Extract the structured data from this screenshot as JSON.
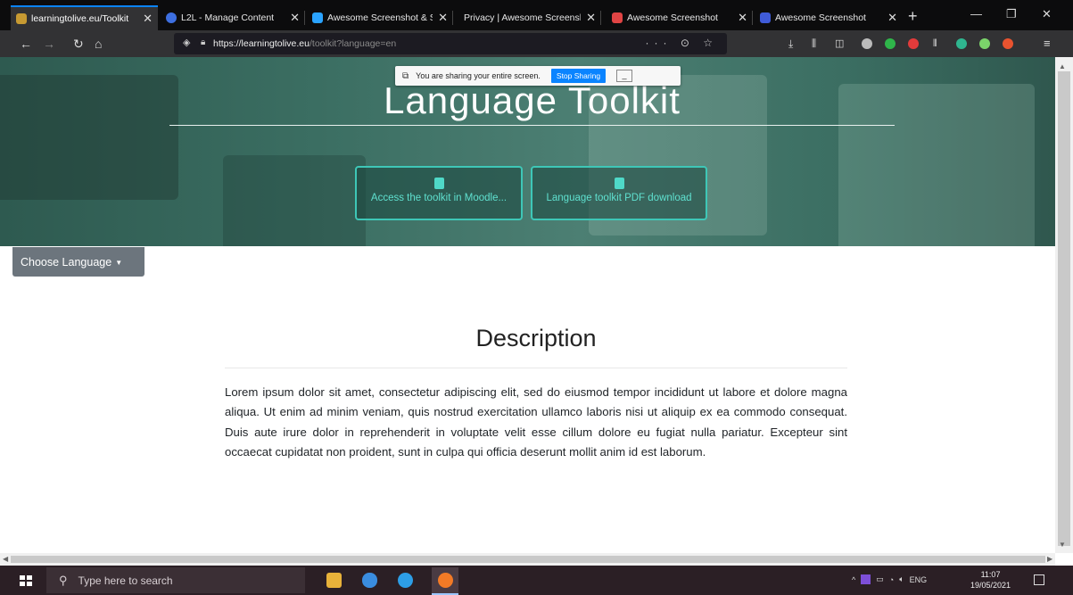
{
  "browser": {
    "tabs": [
      {
        "title": "learningtolive.eu/Toolkit",
        "active": true,
        "favicon_color": "#c79a32"
      },
      {
        "title": "L2L - Manage Content",
        "active": false,
        "favicon_color": "#3d6fe0"
      },
      {
        "title": "Awesome Screenshot & S",
        "active": false,
        "favicon_color": "#2aa3ff"
      },
      {
        "title": "Privacy | Awesome Screenshot",
        "active": false,
        "favicon_color": ""
      },
      {
        "title": "Awesome Screenshot",
        "active": false,
        "favicon_color": "#e04444"
      },
      {
        "title": "Awesome Screenshot",
        "active": false,
        "favicon_color": "#3f5bd8"
      }
    ],
    "close_glyph": "✕",
    "new_tab": "+",
    "url_host": "https://learningtolive.eu",
    "url_path": "/toolkit?language=en",
    "page_actions": "··· ⊙ ☆"
  },
  "share_bar": {
    "message": "You are sharing your entire screen.",
    "stop_label": "Stop Sharing",
    "minimize": "_"
  },
  "hero": {
    "title": "Language Toolkit",
    "buttons": [
      {
        "label": "Access the toolkit in Moodle..."
      },
      {
        "label": "Language toolkit PDF download"
      }
    ]
  },
  "language_dropdown": {
    "label": "Choose Language"
  },
  "description": {
    "title": "Description",
    "body": "Lorem ipsum dolor sit amet, consectetur adipiscing elit, sed do eiusmod tempor incididunt ut labore et dolore magna aliqua. Ut enim ad minim veniam, quis nostrud exercitation ullamco laboris nisi ut aliquip ex ea commodo consequat. Duis aute irure dolor in reprehenderit in voluptate velit esse cillum dolore eu fugiat nulla pariatur. Excepteur sint occaecat cupidatat non proident, sunt in culpa qui officia deserunt mollit anim id est laborum."
  },
  "taskbar": {
    "search_placeholder": "Type here to search",
    "language": "ENG",
    "time": "11:07",
    "date": "19/05/2021"
  },
  "colors": {
    "accent": "#0a84ff",
    "hero_button_border": "#3ec7b7",
    "dropdown_bg": "#6c757d"
  }
}
